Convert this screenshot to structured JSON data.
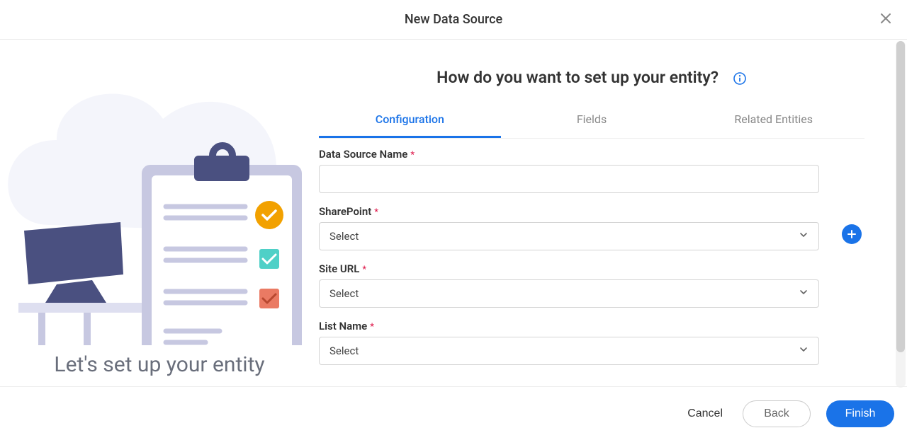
{
  "header": {
    "title": "New Data Source"
  },
  "left": {
    "caption": "Let's set up your entity"
  },
  "right": {
    "heading": "How do you want to set up your entity?"
  },
  "tabs": {
    "configuration": "Configuration",
    "fields": "Fields",
    "related_entities": "Related Entities"
  },
  "form": {
    "data_source_name": {
      "label": "Data Source Name",
      "value": ""
    },
    "sharepoint": {
      "label": "SharePoint",
      "placeholder": "Select"
    },
    "site_url": {
      "label": "Site URL",
      "placeholder": "Select"
    },
    "list_name": {
      "label": "List Name",
      "placeholder": "Select"
    }
  },
  "footer": {
    "cancel": "Cancel",
    "back": "Back",
    "finish": "Finish"
  },
  "colors": {
    "primary": "#1a73e8",
    "accent_orange": "#f2a100",
    "accent_teal": "#4fd0c7",
    "accent_red": "#ea7a63",
    "slate": "#4a5080",
    "lavender": "#c7c8e1"
  }
}
